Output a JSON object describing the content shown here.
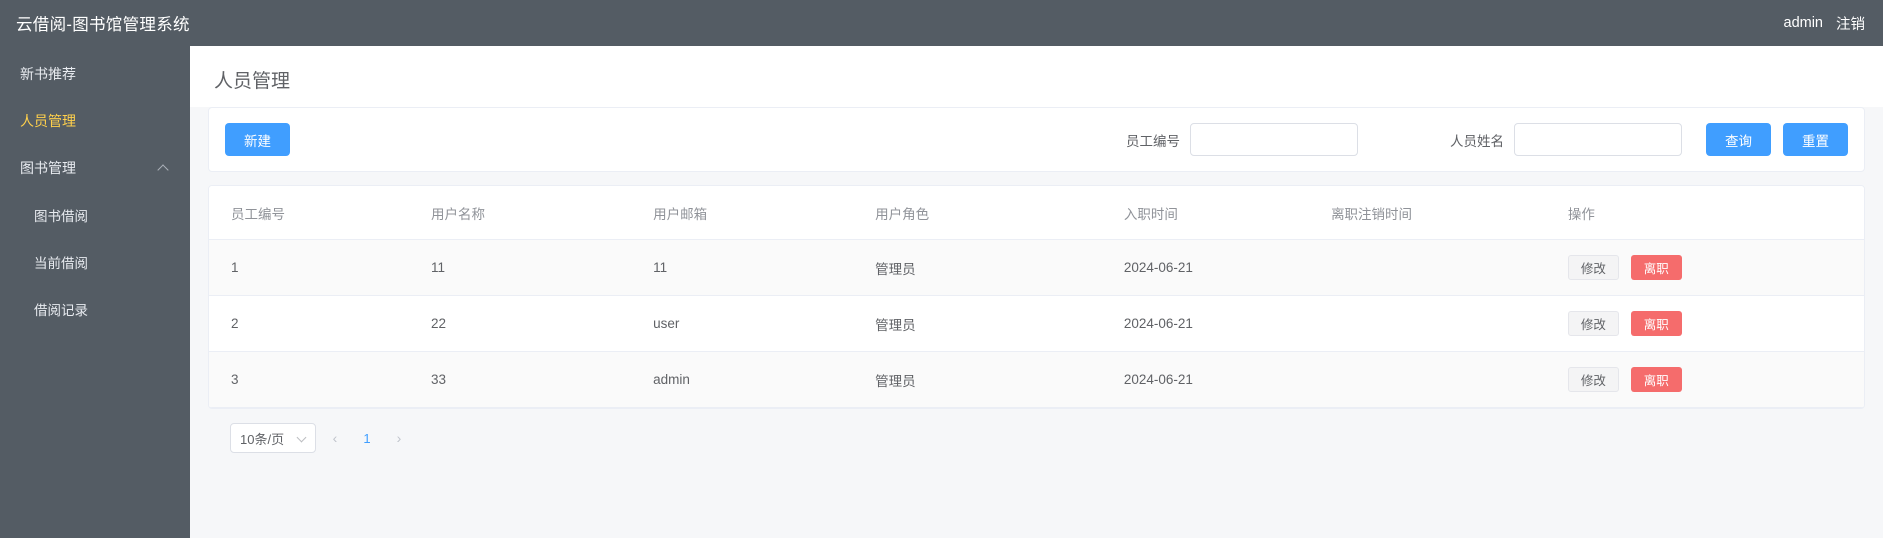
{
  "header": {
    "title": "云借阅-图书馆管理系统",
    "user": "admin",
    "logout": "注销"
  },
  "sidebar": {
    "items": [
      {
        "label": "新书推荐",
        "active": false,
        "sub": false,
        "chevron": false
      },
      {
        "label": "人员管理",
        "active": true,
        "sub": false,
        "chevron": false
      },
      {
        "label": "图书管理",
        "active": false,
        "sub": false,
        "chevron": true
      },
      {
        "label": "图书借阅",
        "active": false,
        "sub": true,
        "chevron": false
      },
      {
        "label": "当前借阅",
        "active": false,
        "sub": true,
        "chevron": false
      },
      {
        "label": "借阅记录",
        "active": false,
        "sub": true,
        "chevron": false
      }
    ]
  },
  "page": {
    "title": "人员管理"
  },
  "toolbar": {
    "create_label": "新建",
    "search_label": "查询",
    "reset_label": "重置",
    "filters": [
      {
        "label": "员工编号",
        "value": "",
        "placeholder": ""
      },
      {
        "label": "人员姓名",
        "value": "",
        "placeholder": ""
      }
    ]
  },
  "table": {
    "columns": [
      "员工编号",
      "用户名称",
      "用户邮箱",
      "用户角色",
      "入职时间",
      "离职注销时间",
      "操作"
    ],
    "rows": [
      {
        "id": "1",
        "name": "11",
        "email": "11",
        "role": "管理员",
        "join": "2024-06-21",
        "leave": ""
      },
      {
        "id": "2",
        "name": "22",
        "email": "user",
        "role": "管理员",
        "join": "2024-06-21",
        "leave": ""
      },
      {
        "id": "3",
        "name": "33",
        "email": "admin",
        "role": "管理员",
        "join": "2024-06-21",
        "leave": ""
      }
    ],
    "actions": {
      "edit": "修改",
      "resign": "离职"
    }
  },
  "pagination": {
    "page_size": "10条/页",
    "prev": "‹",
    "next": "›",
    "pages": [
      "1"
    ],
    "current": "1"
  },
  "colors": {
    "sidebar_bg": "#545c64",
    "accent": "#409eff",
    "active_menu": "#ffd04b",
    "danger": "#f56c6c"
  }
}
